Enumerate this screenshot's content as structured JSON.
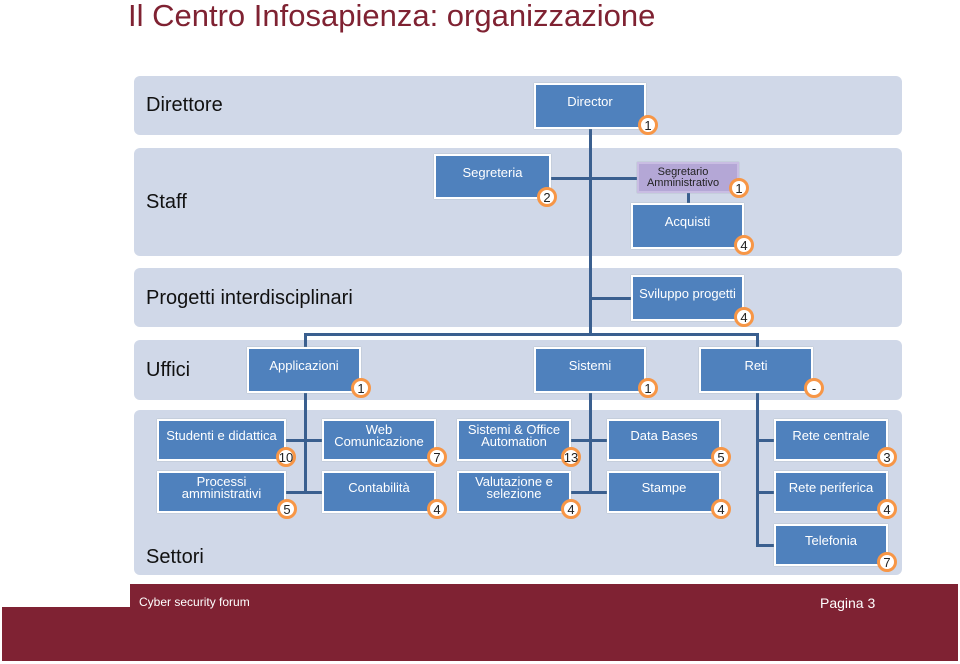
{
  "title": "Il Centro Infosapienza: organizzazione",
  "bands": {
    "direttore": "Direttore",
    "staff": "Staff",
    "progetti": "Progetti interdisciplinari",
    "uffici": "Uffici",
    "settori": "Settori"
  },
  "colors": {
    "title": "#7f2232",
    "box": "#4f81bd",
    "badge_border": "#f79646",
    "band": "#d0d8e8",
    "purple_box": "#b4a7d6",
    "footer": "#7f2233"
  },
  "nodes": {
    "director": {
      "label": "Director",
      "count": "1"
    },
    "segreteria": {
      "label": "Segreteria",
      "count": "2"
    },
    "segretario": {
      "label": "Segretario Amministrativo",
      "count": "1"
    },
    "acquisti": {
      "label": "Acquisti",
      "count": "4"
    },
    "sviluppo": {
      "label": "Sviluppo progetti",
      "count": "4"
    },
    "applicazioni": {
      "label": "Applicazioni",
      "count": "1"
    },
    "sistemi": {
      "label": "Sistemi",
      "count": "1"
    },
    "reti": {
      "label": "Reti",
      "count": "-"
    },
    "studenti": {
      "label": "Studenti e didattica",
      "count": "10"
    },
    "processi": {
      "label": "Processi amministrativi",
      "count": "5"
    },
    "web": {
      "label": "Web Comunicazione",
      "count": "7"
    },
    "contabilita": {
      "label": "Contabilità",
      "count": "4"
    },
    "sistemi_oa": {
      "label": "Sistemi & Office Automation",
      "count": "13"
    },
    "valutazione": {
      "label": "Valutazione e selezione",
      "count": "4"
    },
    "database": {
      "label": "Data Bases",
      "count": "5"
    },
    "stampe": {
      "label": "Stampe",
      "count": "4"
    },
    "rete_centrale": {
      "label": "Rete centrale",
      "count": "3"
    },
    "rete_periferica": {
      "label": "Rete periferica",
      "count": "4"
    },
    "telefonia": {
      "label": "Telefonia",
      "count": "7"
    }
  },
  "footer": {
    "text": "Cyber security forum",
    "page": "Pagina 3"
  }
}
